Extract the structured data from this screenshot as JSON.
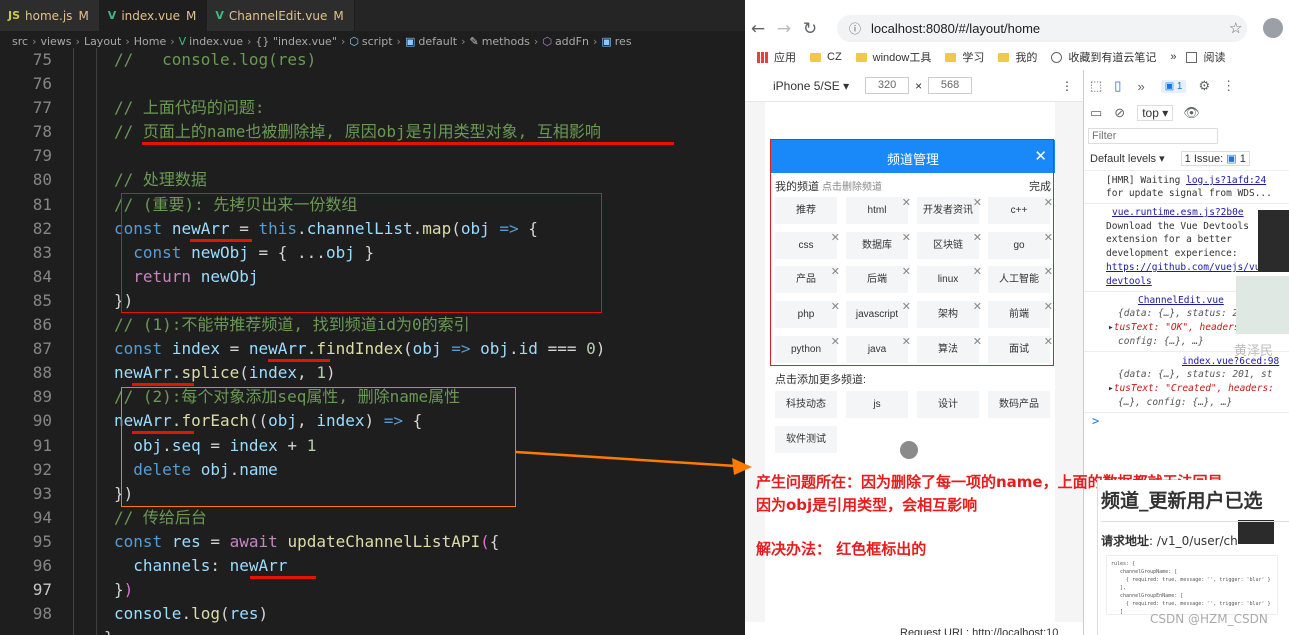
{
  "editor": {
    "tabs": [
      {
        "icon": "JS",
        "name": "home.js",
        "status": "M",
        "active": false
      },
      {
        "icon": "V",
        "name": "index.vue",
        "status": "M",
        "active": true
      },
      {
        "icon": "V",
        "name": "ChannelEdit.vue",
        "status": "M",
        "active": false
      }
    ],
    "breadcrumb": [
      "src",
      "views",
      "Layout",
      "Home",
      "index.vue",
      "{} \"index.vue\"",
      "script",
      "default",
      "methods",
      "addFn",
      "res"
    ],
    "current_line": 97
  },
  "browser": {
    "url": "localhost:8080/#/layout/home",
    "bookmarks": [
      "应用",
      "CZ",
      "window工具",
      "学习",
      "我的",
      "收藏到有道云笔记",
      "阅读"
    ],
    "device": "iPhone 5/SE",
    "width": "320",
    "height": "568",
    "channel_popup": {
      "title": "频道管理",
      "my_channels_label": "我的频道",
      "delete_hint": "点击删除频道",
      "done_label": "完成",
      "my_channels": [
        "推荐",
        "html",
        "开发者资讯",
        "c++",
        "css",
        "数据库",
        "区块链",
        "go",
        "产品",
        "后端",
        "linux",
        "人工智能",
        "php",
        "javascript",
        "架构",
        "前端",
        "python",
        "java",
        "算法",
        "面试"
      ],
      "more_label": "点击添加更多频道:",
      "more_channels": [
        "科技动态",
        "js",
        "设计",
        "数码产品",
        "软件测试"
      ]
    },
    "devtools": {
      "context": "top",
      "filter_placeholder": "Filter",
      "levels": "Default levels",
      "issues": "1 Issue:",
      "issue_count": "1",
      "badge_count": "1",
      "console": {
        "hmr_1": "[HMR] Waiting",
        "hmr_link": "log.js?1afd:24",
        "hmr_2": "for update signal from WDS...",
        "vue_link": "vue.runtime.esm.js?2b0e",
        "devtools_1": "Download the Vue Devtools",
        "devtools_2": "extension for a better",
        "devtools_3": "development experience:",
        "devtools_url": "https://github.com/vuejs/vue-",
        "devtools_4": "devtools",
        "chanedit_link": "ChannelEdit.vue",
        "obj1_a": "{data: {…}, status: 200, s",
        "obj1_b": "tusText: \"OK\", headers",
        "obj1_c": "config: {…}, …}",
        "index_link": "index.vue?6ced:98",
        "obj2_a": "{data: {…}, status: 201, st",
        "obj2_b": "tusText: \"Created\", headers:",
        "obj2_c": "{…}, config: {…}, …}",
        "prompt": ">"
      }
    }
  },
  "annotations": {
    "problem_line1": "产生问题所在：因为删除了每一项的name，上面的数据都就无法回显",
    "problem_line2": "因为obj是引用类型，会相互影响",
    "solution": "解决办法： 红色框标出的"
  },
  "doc": {
    "title": "频道_更新用户已选",
    "url_label": "请求地址",
    "url_value": ": /v1_0/user/ch",
    "request_url": "Request URL: http://localhost:10",
    "watermark": "CSDN @HZM_CSDN",
    "name_watermark": "黄泽民"
  },
  "colors": {
    "editor_bg": "#1e1e1e",
    "header_blue": "#1989fa",
    "annotation_red": "#e81c1c",
    "box_red": "#e51400",
    "box_orange": "#ff7b00"
  }
}
